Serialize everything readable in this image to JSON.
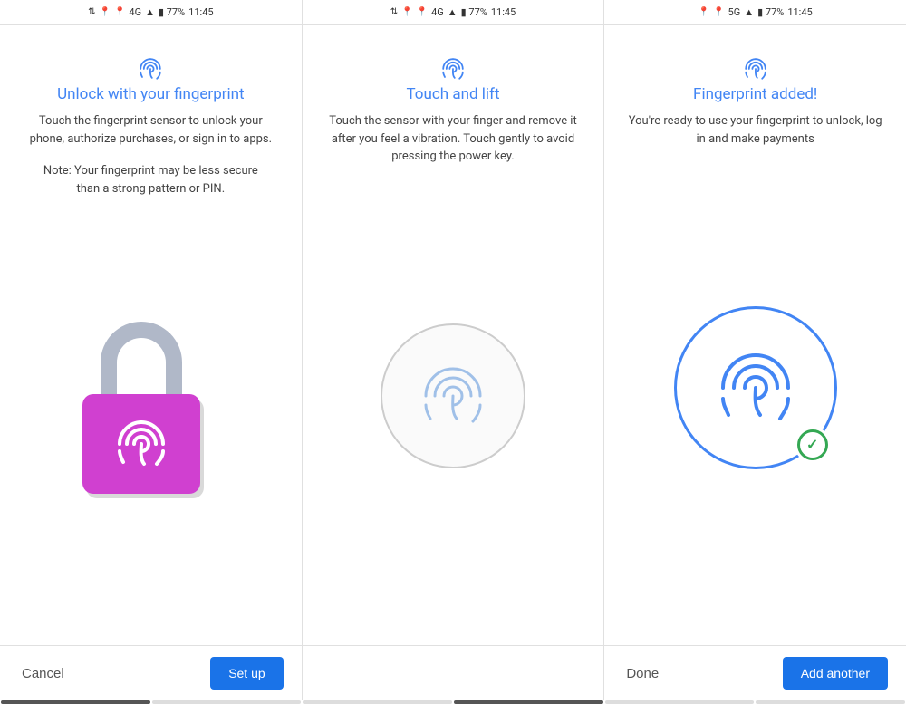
{
  "statusBars": [
    {
      "id": "bar1",
      "signal": "⇅",
      "location": "●",
      "location2": "●",
      "network": "4G",
      "signal2": "▲",
      "battery": "▮ 77%",
      "time": "11:45"
    },
    {
      "id": "bar2",
      "signal": "⇅",
      "location": "●",
      "location2": "●",
      "network": "4G",
      "signal2": "▲",
      "battery": "▮ 77%",
      "time": "11:45"
    },
    {
      "id": "bar3",
      "signal": "",
      "location": "●",
      "location2": "●",
      "network": "5G",
      "signal2": "▲",
      "battery": "▮ 77%",
      "time": "11:45"
    }
  ],
  "panels": [
    {
      "id": "panel1",
      "title": "Unlock with your fingerprint",
      "description": "Touch the fingerprint sensor to unlock your phone, authorize purchases, or sign in to apps.",
      "note": "Note: Your fingerprint may be less secure than a strong pattern or PIN.",
      "illustration": "lock"
    },
    {
      "id": "panel2",
      "title": "Touch and lift",
      "description": "Touch the sensor with your finger and remove it after you feel a vibration. Touch gently to avoid pressing the power key.",
      "note": "",
      "illustration": "touch-circle"
    },
    {
      "id": "panel3",
      "title": "Fingerprint added!",
      "description": "You're ready to use your fingerprint to unlock, log in and make payments",
      "note": "",
      "illustration": "added-circle"
    }
  ],
  "bottomBars": [
    {
      "id": "bar1",
      "leftButton": {
        "label": "Cancel",
        "type": "text"
      },
      "rightButton": {
        "label": "Set up",
        "type": "primary"
      }
    },
    {
      "id": "bar2",
      "leftButton": null,
      "rightButton": null
    },
    {
      "id": "bar3",
      "leftButton": {
        "label": "Done",
        "type": "text"
      },
      "rightButton": {
        "label": "Add another",
        "type": "primary"
      }
    }
  ]
}
